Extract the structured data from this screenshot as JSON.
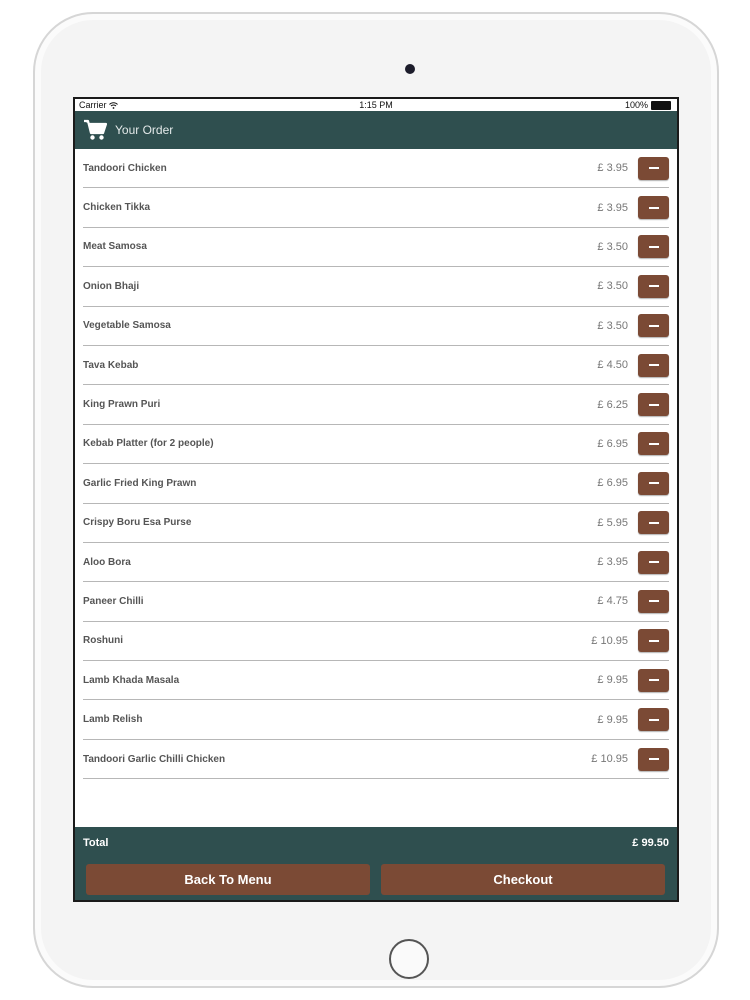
{
  "status_bar": {
    "carrier": "Carrier",
    "time": "1:15 PM",
    "battery": "100%"
  },
  "header": {
    "title": "Your Order",
    "icon": "cart-icon"
  },
  "items": [
    {
      "name": "Tandoori Chicken",
      "price": "£ 3.95"
    },
    {
      "name": "Chicken Tikka",
      "price": "£ 3.95"
    },
    {
      "name": "Meat Samosa",
      "price": "£ 3.50"
    },
    {
      "name": "Onion Bhaji",
      "price": "£ 3.50"
    },
    {
      "name": "Vegetable Samosa",
      "price": "£ 3.50"
    },
    {
      "name": "Tava Kebab",
      "price": "£ 4.50"
    },
    {
      "name": "King Prawn Puri",
      "price": "£ 6.25"
    },
    {
      "name": "Kebab Platter (for 2 people)",
      "price": "£ 6.95"
    },
    {
      "name": "Garlic Fried King Prawn",
      "price": "£ 6.95"
    },
    {
      "name": "Crispy Boru Esa Purse",
      "price": "£ 5.95"
    },
    {
      "name": "Aloo Bora",
      "price": "£ 3.95"
    },
    {
      "name": "Paneer Chilli",
      "price": "£ 4.75"
    },
    {
      "name": "Roshuni",
      "price": "£ 10.95"
    },
    {
      "name": "Lamb Khada Masala",
      "price": "£ 9.95"
    },
    {
      "name": "Lamb Relish",
      "price": "£ 9.95"
    },
    {
      "name": "Tandoori Garlic Chilli Chicken",
      "price": "£ 10.95"
    }
  ],
  "total": {
    "label": "Total",
    "value": "£ 99.50"
  },
  "buttons": {
    "back": "Back To Menu",
    "checkout": "Checkout"
  },
  "colors": {
    "header": "#2f4f4f",
    "button": "#7b4a35"
  }
}
